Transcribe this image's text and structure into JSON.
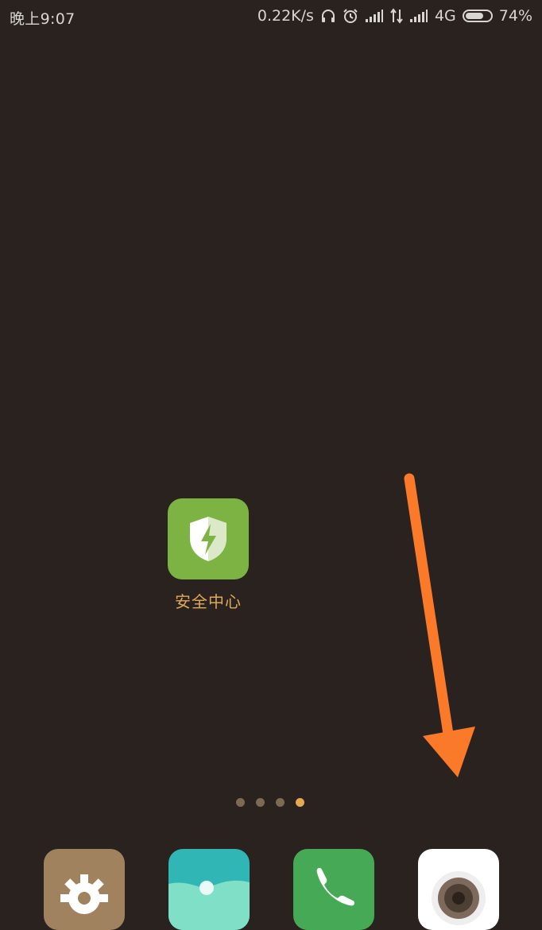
{
  "status_bar": {
    "time": "晚上9:07",
    "net_speed": "0.22K/s",
    "network": "4G",
    "battery_percent": "74%",
    "battery_level": 0.74
  },
  "home": {
    "apps": [
      {
        "label": "安全中心",
        "icon": "shield-bolt-icon",
        "color": "#7cb342"
      }
    ],
    "page_dots": {
      "count": 4,
      "active_index": 3
    }
  },
  "dock": {
    "apps": [
      {
        "name": "settings",
        "icon": "gear-icon",
        "color": "#a0825e"
      },
      {
        "name": "gallery",
        "icon": "landscape-icon",
        "color": "#30b6b5"
      },
      {
        "name": "phone",
        "icon": "phone-icon",
        "color": "#45a956"
      },
      {
        "name": "camera",
        "icon": "camera-lens-icon",
        "color": "#ffffff"
      }
    ]
  },
  "annotation": {
    "shape": "arrow-icon",
    "color": "#fb7a2a"
  }
}
